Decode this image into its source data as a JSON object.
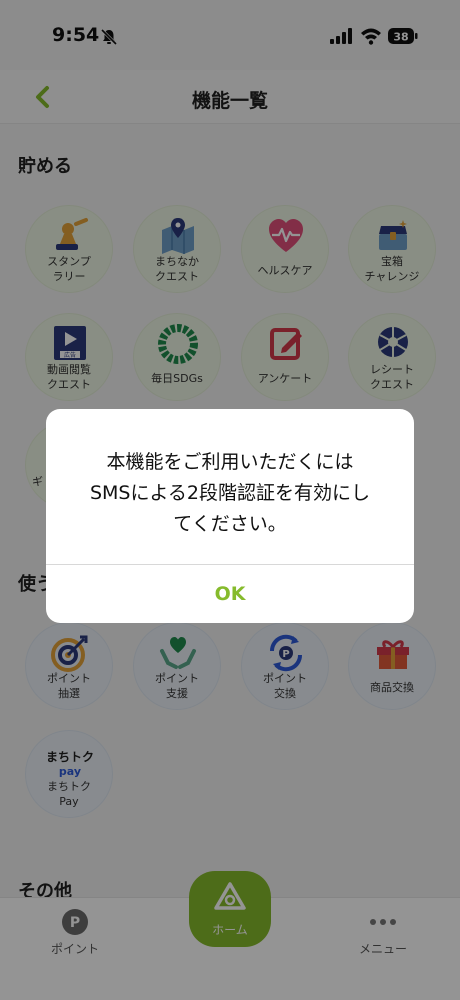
{
  "status_bar": {
    "time": "9:54",
    "battery": "38"
  },
  "header": {
    "title": "機能一覧"
  },
  "sections": {
    "save": "貯める",
    "use": "使う",
    "other": "その他"
  },
  "save_items": [
    {
      "label": "スタンプ\nラリー",
      "icon": "stamp-icon"
    },
    {
      "label": "まちなか\nクエスト",
      "icon": "map-pin-icon"
    },
    {
      "label": "ヘルスケア",
      "icon": "heart-pulse-icon"
    },
    {
      "label": "宝箱\nチャレンジ",
      "icon": "treasure-chest-icon"
    },
    {
      "label": "動画閲覧\nクエスト",
      "icon": "video-ad-icon",
      "badge": "広告"
    },
    {
      "label": "毎日SDGs",
      "icon": "sdgs-wheel-icon"
    },
    {
      "label": "アンケート",
      "icon": "survey-edit-icon"
    },
    {
      "label": "レシート\nクエスト",
      "icon": "camera-shutter-icon"
    },
    {
      "label": "ギ",
      "icon": "gift-icon"
    }
  ],
  "use_items": [
    {
      "label": "ポイント\n抽選",
      "icon": "target-icon"
    },
    {
      "label": "ポイント\n支援",
      "icon": "heart-hands-icon"
    },
    {
      "label": "ポイント\n交換",
      "icon": "point-exchange-icon",
      "glyph": "P"
    },
    {
      "label": "商品交換",
      "icon": "gift-box-icon"
    },
    {
      "label": "まちトク\nPay",
      "icon": "machitoku-pay-logo",
      "logo_top": "まちトク",
      "logo_bottom": "pay"
    }
  ],
  "bottom_nav": {
    "points": "ポイント",
    "points_glyph": "P",
    "home": "ホーム",
    "menu": "メニュー"
  },
  "dialog": {
    "message": "本機能をご利用いただくには\nSMSによる2段階認証を有効にし\nてください。",
    "ok": "OK"
  },
  "colors": {
    "accent": "#86bb2c",
    "background": "#f2f2f2",
    "save_circle": "#edf5e3",
    "use_circle": "#eaf0f7"
  }
}
